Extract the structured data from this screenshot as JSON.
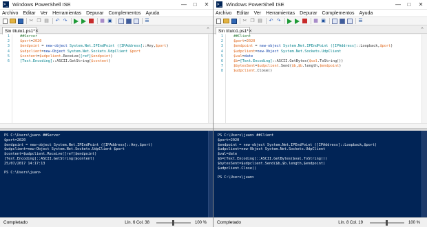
{
  "menus": [
    "Archivo",
    "Editar",
    "Ver",
    "Herramientas",
    "Depurar",
    "Complementos",
    "Ayuda"
  ],
  "windows": [
    {
      "title": "Windows PowerShell ISE",
      "tab_label": "Sin título1.ps1*",
      "editor_lines": [
        [
          {
            "t": " ##Server",
            "c": "comment"
          }
        ],
        [
          {
            "t": " $port",
            "c": "var"
          },
          {
            "t": "=",
            "c": "plain"
          },
          {
            "t": "2020",
            "c": "var"
          }
        ],
        [
          {
            "t": " $endpoint",
            "c": "var"
          },
          {
            "t": " = ",
            "c": "plain"
          },
          {
            "t": "new-object",
            "c": "cmd"
          },
          {
            "t": " System.Net.IPEndPoint ",
            "c": "type"
          },
          {
            "t": "([IPAddress]",
            "c": "type"
          },
          {
            "t": "::Any,",
            "c": "plain"
          },
          {
            "t": "$port",
            "c": "var"
          },
          {
            "t": ")",
            "c": "plain"
          }
        ],
        [
          {
            "t": " $udpclient",
            "c": "var"
          },
          {
            "t": "=",
            "c": "plain"
          },
          {
            "t": "new-Object",
            "c": "cmd"
          },
          {
            "t": " System.Net.Sockets.UdpClient ",
            "c": "type"
          },
          {
            "t": "$port",
            "c": "var"
          }
        ],
        [
          {
            "t": " $content",
            "c": "var"
          },
          {
            "t": "=",
            "c": "plain"
          },
          {
            "t": "$udpclient",
            "c": "var"
          },
          {
            "t": ".Receive(",
            "c": "plain"
          },
          {
            "t": "[ref]",
            "c": "type"
          },
          {
            "t": "$endpoint",
            "c": "var"
          },
          {
            "t": ")",
            "c": "plain"
          }
        ],
        [
          {
            "t": " [Text.Encoding]",
            "c": "type"
          },
          {
            "t": "::ASCII.GetString(",
            "c": "plain"
          },
          {
            "t": "$content",
            "c": "var"
          },
          {
            "t": ")",
            "c": "plain"
          }
        ]
      ],
      "console_lines": [
        "PS C:\\Users\\juan> ##Server",
        "$port=2020",
        "$endpoint = new-object System.Net.IPEndPoint ([IPAddress]::Any,$port)",
        "$udpclient=new-Object System.Net.Sockets.UdpClient $port",
        "$content=$udpclient.Receive([ref]$endpoint)",
        "[Text.Encoding]::ASCII.GetString($content)",
        "25/07/2017 14:17:13",
        "",
        "PS C:\\Users\\juan>"
      ],
      "status": "Completado",
      "position": "Lín. 6  Col. 38",
      "zoom": "100 %",
      "zoom_level": 0.5
    },
    {
      "title": "Windows PowerShell ISE",
      "tab_label": "Sin título1.ps1*",
      "editor_lines": [
        [
          {
            "t": " ##Client",
            "c": "comment"
          }
        ],
        [
          {
            "t": " $port",
            "c": "var"
          },
          {
            "t": "=",
            "c": "plain"
          },
          {
            "t": "2020",
            "c": "var"
          }
        ],
        [
          {
            "t": " $endpoint",
            "c": "var"
          },
          {
            "t": " = ",
            "c": "plain"
          },
          {
            "t": "new-object",
            "c": "cmd"
          },
          {
            "t": " System.Net.IPEndPoint ",
            "c": "type"
          },
          {
            "t": "([IPAddress]",
            "c": "type"
          },
          {
            "t": "::Loopback,",
            "c": "plain"
          },
          {
            "t": "$port",
            "c": "var"
          },
          {
            "t": ")",
            "c": "plain"
          }
        ],
        [
          {
            "t": " $udpclient",
            "c": "var"
          },
          {
            "t": "=",
            "c": "plain"
          },
          {
            "t": "new-Object",
            "c": "cmd"
          },
          {
            "t": " System.Net.Sockets.UdpClient",
            "c": "type"
          }
        ],
        [
          {
            "t": " $val",
            "c": "var"
          },
          {
            "t": "=",
            "c": "plain"
          },
          {
            "t": "date",
            "c": "cmd"
          }
        ],
        [
          {
            "t": " $b",
            "c": "var"
          },
          {
            "t": "=",
            "c": "plain"
          },
          {
            "t": "[Text.Encoding]",
            "c": "type"
          },
          {
            "t": "::ASCII.GetBytes(",
            "c": "plain"
          },
          {
            "t": "$val",
            "c": "var"
          },
          {
            "t": ".ToString())",
            "c": "plain"
          }
        ],
        [
          {
            "t": " $bytesSent",
            "c": "var"
          },
          {
            "t": "=",
            "c": "plain"
          },
          {
            "t": "$udpclient",
            "c": "var"
          },
          {
            "t": ".Send(",
            "c": "plain"
          },
          {
            "t": "$b",
            "c": "var"
          },
          {
            "t": ",",
            "c": "plain"
          },
          {
            "t": "$b",
            "c": "var"
          },
          {
            "t": ".length,",
            "c": "plain"
          },
          {
            "t": "$endpoint",
            "c": "var"
          },
          {
            "t": ")",
            "c": "plain"
          }
        ],
        [
          {
            "t": " $udpclient",
            "c": "var"
          },
          {
            "t": ".Close()",
            "c": "plain"
          }
        ]
      ],
      "console_lines": [
        "PS C:\\Users\\juan> ##Client",
        "$port=2020",
        "$endpoint = new-object System.Net.IPEndPoint ([IPAddress]::Loopback,$port)",
        "$udpclient=new-Object System.Net.Sockets.UdpClient",
        "$val=date",
        "$b=[Text.Encoding]::ASCII.GetBytes($val.ToString())",
        "$bytesSent=$udpclient.Send($b,$b.length,$endpoint)",
        "$udpclient.Close()",
        "",
        "PS C:\\Users\\juan>"
      ],
      "status": "Completado",
      "position": "Lín. 8  Col. 19",
      "zoom": "100 %",
      "zoom_level": 0.5
    }
  ]
}
